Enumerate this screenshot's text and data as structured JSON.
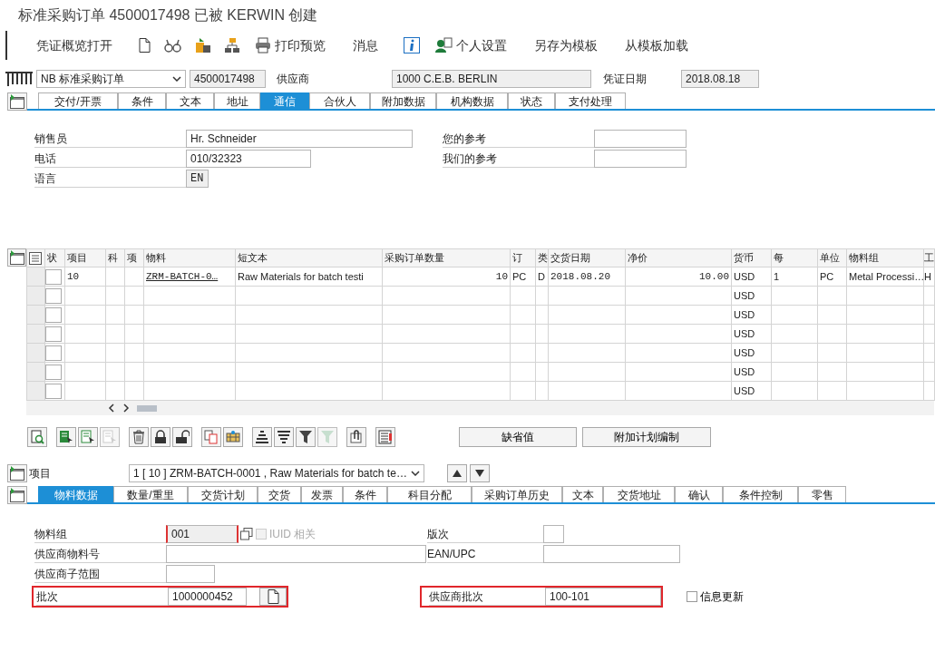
{
  "window": {
    "title": "标准采购订单 4500017498 已被 KERWIN 创建"
  },
  "toolbar": [
    {
      "kind": "text",
      "label": "凭证概览打开"
    },
    {
      "kind": "icon"
    },
    {
      "kind": "icon"
    },
    {
      "kind": "icon"
    },
    {
      "kind": "icon"
    },
    {
      "kind": "icon_text",
      "label": "打印预览"
    },
    {
      "kind": "text",
      "label": "消息"
    },
    {
      "kind": "icon"
    },
    {
      "kind": "icon_text",
      "label": "个人设置"
    },
    {
      "kind": "text",
      "label": "另存为模板"
    },
    {
      "kind": "text",
      "label": "从模板加载"
    }
  ],
  "header": {
    "document_type": "NB 标准采购订单",
    "document_number": {
      "value": "4500017498",
      "display_only": true
    },
    "vendor_label": "供应商",
    "vendor": {
      "value": "1000 C.E.B. BERLIN",
      "display_only": true
    },
    "date_label": "凭证日期",
    "date": {
      "value": "2018.08.18",
      "display_only": true
    }
  },
  "header_tabs": [
    {
      "label": "交付/开票",
      "selected": false
    },
    {
      "label": "条件",
      "selected": false
    },
    {
      "label": "文本",
      "selected": false
    },
    {
      "label": "地址",
      "selected": false
    },
    {
      "label": "通信",
      "selected": true
    },
    {
      "label": "合伙人",
      "selected": false
    },
    {
      "label": "附加数据",
      "selected": false
    },
    {
      "label": "机构数据",
      "selected": false
    },
    {
      "label": "状态",
      "selected": false
    },
    {
      "label": "支付处理",
      "selected": false
    }
  ],
  "communication": {
    "left": [
      {
        "label": "销售员",
        "value": "Hr. Schneider",
        "display_only": false
      },
      {
        "label": "电话",
        "value": "010/32323",
        "display_only": false
      },
      {
        "label": "语言",
        "value": "EN",
        "display_only": true
      }
    ],
    "right": [
      {
        "label": "您的参考",
        "display_only": false
      },
      {
        "label": "我们的参考",
        "display_only": false
      }
    ]
  },
  "items_table": {
    "columns": [
      {
        "kind": "selector"
      },
      {
        "kind": "box",
        "label": "状"
      },
      {
        "kind": "text",
        "label": "项目"
      },
      {
        "kind": "text",
        "label": "科"
      },
      {
        "kind": "text",
        "label": "项"
      },
      {
        "kind": "link",
        "label": "物料"
      },
      {
        "kind": "text",
        "label": "短文本"
      },
      {
        "kind": "number",
        "label": "采购订单数量"
      },
      {
        "kind": "text",
        "label": "订"
      },
      {
        "kind": "text",
        "label": "类"
      },
      {
        "kind": "text",
        "label": "交货日期"
      },
      {
        "kind": "number",
        "label": "净价"
      },
      {
        "kind": "text",
        "label": "货币"
      },
      {
        "kind": "text",
        "label": "每"
      },
      {
        "kind": "text",
        "label": "单位"
      },
      {
        "kind": "text",
        "label": "物料组"
      },
      {
        "kind": "text",
        "label": "工"
      }
    ],
    "rows": [
      {
        "item": "10",
        "material": "ZRM-BATCH-0…",
        "short_text": "Raw Materials for batch testi",
        "quantity": "10",
        "unit": "PC",
        "date_type": "D",
        "delivery_date": "2018.08.20",
        "net_price": "10.00",
        "currency": "USD",
        "per": "1",
        "price_unit": "PC",
        "material_group": "Metal Processi…",
        "plant": "H"
      },
      {
        "currency": "USD"
      },
      {
        "currency": "USD"
      },
      {
        "currency": "USD"
      },
      {
        "currency": "USD"
      },
      {
        "currency": "USD"
      },
      {
        "currency": "USD"
      }
    ]
  },
  "item_toolbar": {
    "groups": [
      [
        {
          "disabled": false
        }
      ],
      [
        {
          "disabled": false
        },
        {
          "disabled": false
        },
        {
          "disabled": true
        }
      ],
      [
        {
          "disabled": false
        },
        {
          "disabled": false
        },
        {
          "disabled": false
        }
      ],
      [
        {
          "disabled": false
        },
        {
          "disabled": false
        }
      ],
      [
        {
          "disabled": false
        },
        {
          "disabled": false
        },
        {
          "disabled": false
        },
        {
          "disabled": true
        }
      ],
      [
        {
          "disabled": false
        }
      ],
      [
        {
          "disabled": false
        }
      ]
    ],
    "buttons": [
      "缺省值",
      "附加计划编制"
    ]
  },
  "item_selector": {
    "label": "项目",
    "value": "1 [ 10 ] ZRM-BATCH-0001 , Raw Materials for batch te…"
  },
  "item_tabs": [
    {
      "label": "物料数据",
      "selected": true
    },
    {
      "label": "数量/重里",
      "selected": false
    },
    {
      "label": "交货计划",
      "selected": false
    },
    {
      "label": "交货",
      "selected": false
    },
    {
      "label": "发票",
      "selected": false
    },
    {
      "label": "条件",
      "selected": false
    },
    {
      "label": "科目分配",
      "selected": false
    },
    {
      "label": "采购订单历史",
      "selected": false
    },
    {
      "label": "文本",
      "selected": false
    },
    {
      "label": "交货地址",
      "selected": false
    },
    {
      "label": "确认",
      "selected": false
    },
    {
      "label": "条件控制",
      "selected": false
    },
    {
      "label": "零售",
      "selected": false
    }
  ],
  "item_detail": {
    "rows": [
      {
        "left": {
          "label": "物料组",
          "value": "001",
          "display_only": true,
          "focused": true,
          "iuid": {
            "label": "IUID 相关",
            "checked": false,
            "disabled": true
          }
        },
        "right": {
          "label": "版次",
          "highlighted": false
        }
      },
      {
        "left": {
          "label": "供应商物料号",
          "highlighted": false
        },
        "right": {
          "label": "EAN/UPC",
          "highlighted": false
        }
      },
      {
        "left": {
          "label": "供应商子范围",
          "highlighted": false
        }
      },
      {
        "left": {
          "label": "批次",
          "value": "1000000452",
          "highlighted": true,
          "has_button": true
        },
        "right": {
          "label": "供应商批次",
          "value": "100-101",
          "highlighted": true
        }
      }
    ],
    "info_update": {
      "label": "信息更新",
      "checked": false
    }
  }
}
